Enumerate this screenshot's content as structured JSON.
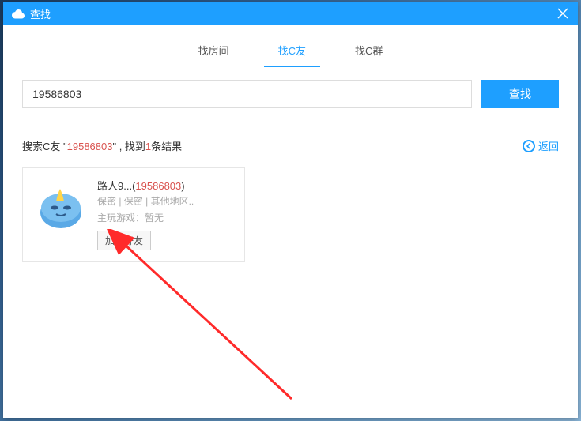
{
  "window": {
    "title": "查找"
  },
  "tabs": {
    "room": "找房间",
    "friend": "找C友",
    "group": "找C群"
  },
  "search": {
    "value": "19586803",
    "button": "查找"
  },
  "result_header": {
    "prefix": "搜索C友 \"",
    "query": "19586803",
    "mid": "\" , 找到",
    "count": "1",
    "suffix": "条结果"
  },
  "back": {
    "label": "返回"
  },
  "card": {
    "name": "路人9...",
    "uid_open": "(",
    "uid": "19586803",
    "uid_close": ")",
    "meta": "保密 | 保密 | 其他地区..",
    "game_label": "主玩游戏：",
    "game_value": "暂无",
    "add_button": "加为好友"
  }
}
